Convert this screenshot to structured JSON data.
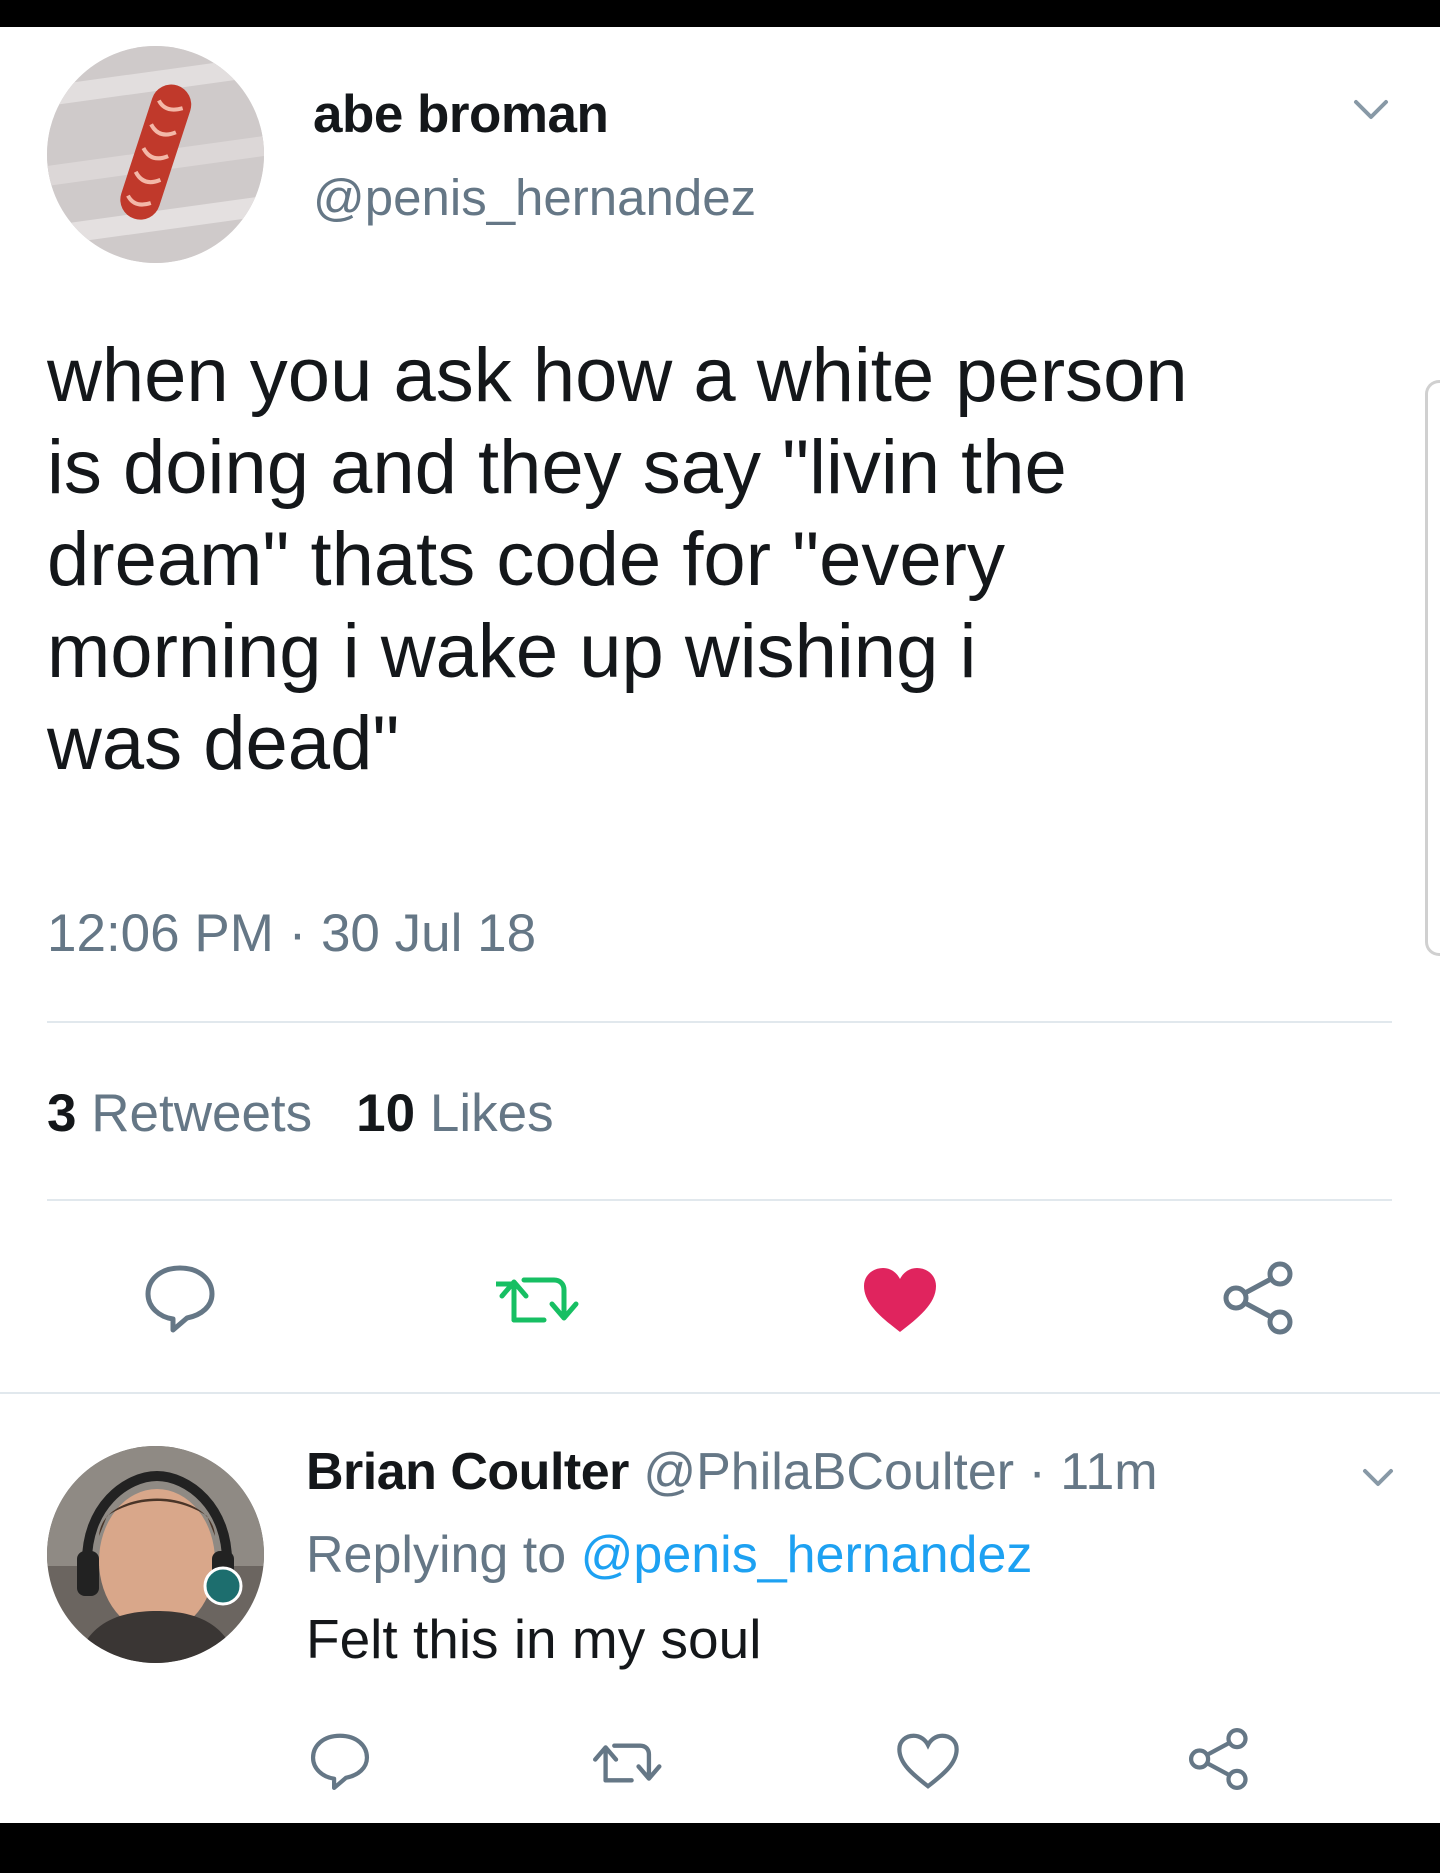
{
  "tweet": {
    "author": {
      "display_name": "abe broman",
      "handle": "@penis_hernandez"
    },
    "text": "when you ask how a white person\nis doing and they say \"livin the\ndream\" thats code for \"every\nmorning i wake up wishing i\nwas dead\"",
    "timestamp": "12:06 PM · 30 Jul 18",
    "stats": {
      "retweets_count": "3",
      "retweets_label": "Retweets",
      "likes_count": "10",
      "likes_label": "Likes"
    },
    "actions": [
      "reply-icon",
      "retweet-icon",
      "like-icon",
      "share-icon"
    ],
    "colors": {
      "retweet": "#17bf63",
      "like": "#e0245e"
    }
  },
  "reply": {
    "author": {
      "display_name": "Brian Coulter",
      "handle": "@PhilaBCoulter",
      "time": " · 11m"
    },
    "replying_prefix": "Replying to ",
    "replying_to": "@penis_hernandez",
    "text": "Felt this in my soul",
    "actions": [
      "reply-icon",
      "retweet-icon",
      "like-icon",
      "share-icon"
    ]
  },
  "colors": {
    "text_primary": "#14171a",
    "text_secondary": "#657786",
    "link": "#1da1f2",
    "divider": "#e1e8ed"
  }
}
